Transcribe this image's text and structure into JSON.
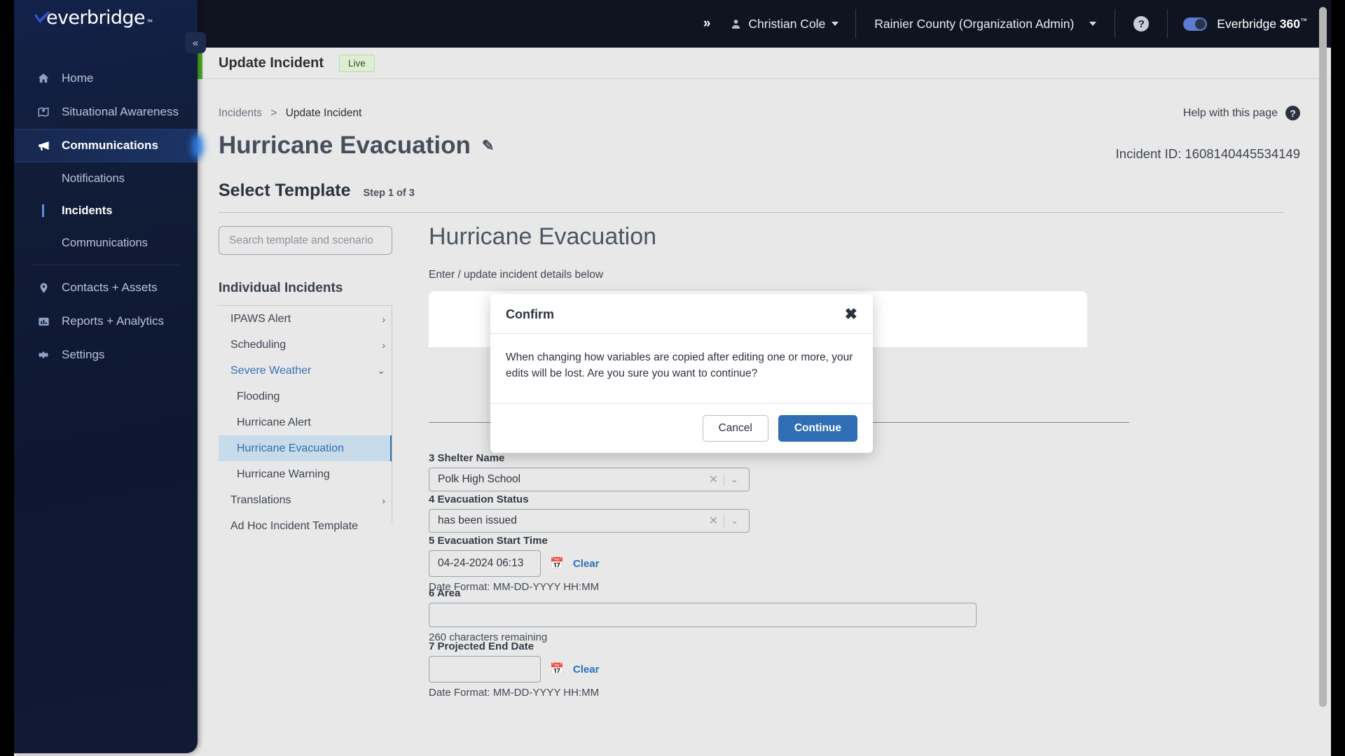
{
  "topbar": {
    "expand_icon": "double-chevron-right-icon",
    "user_name": "Christian Cole",
    "organization": "Rainier County (Organization Admin)",
    "help_icon": "question-mark-icon",
    "brand_label": "Everbridge 360",
    "brand_tm": "™",
    "toggle_state": "on"
  },
  "sidebar": {
    "logo_text": "everbridge",
    "logo_tm": "™",
    "collapse_icon": "double-chevron-left-icon",
    "items": [
      {
        "label": "Home",
        "icon": "home-icon",
        "active": false
      },
      {
        "label": "Situational Awareness",
        "icon": "map-pin-icon",
        "active": false
      },
      {
        "label": "Communications",
        "icon": "megaphone-icon",
        "active": true
      },
      {
        "label": "Contacts + Assets",
        "icon": "location-pin-icon",
        "active": false
      },
      {
        "label": "Reports + Analytics",
        "icon": "bar-chart-icon",
        "active": false
      },
      {
        "label": "Settings",
        "icon": "gear-icon",
        "active": false
      }
    ],
    "sub_items": [
      {
        "label": "Notifications",
        "selected": false
      },
      {
        "label": "Incidents",
        "selected": true
      },
      {
        "label": "Communications",
        "selected": false
      }
    ]
  },
  "page_header": {
    "title": "Update Incident",
    "status_badge": "Live"
  },
  "breadcrumb": {
    "parent": "Incidents",
    "separator": ">",
    "current": "Update Incident"
  },
  "help": {
    "label": "Help with this page",
    "icon": "question-mark-icon"
  },
  "incident": {
    "name": "Hurricane Evacuation",
    "edit_icon": "pencil-icon",
    "id_label": "Incident ID: 1608140445534149"
  },
  "step": {
    "heading": "Select Template",
    "progress": "Step 1 of 3"
  },
  "template_panel": {
    "search_placeholder": "Search template and scenario",
    "search_value": "",
    "group_heading": "Individual Incidents",
    "tree": [
      {
        "label": "IPAWS Alert",
        "type": "group",
        "state": "collapsed",
        "icon": "chevron-right-icon"
      },
      {
        "label": "Scheduling",
        "type": "group",
        "state": "collapsed",
        "icon": "chevron-right-icon"
      },
      {
        "label": "Severe Weather",
        "type": "group",
        "state": "expanded",
        "icon": "chevron-down-icon"
      },
      {
        "label": "Flooding",
        "type": "leaf",
        "active": false
      },
      {
        "label": "Hurricane Alert",
        "type": "leaf",
        "active": false
      },
      {
        "label": "Hurricane Evacuation",
        "type": "leaf",
        "active": true
      },
      {
        "label": "Hurricane Warning",
        "type": "leaf",
        "active": false
      },
      {
        "label": "Translations",
        "type": "group",
        "state": "collapsed",
        "icon": "chevron-right-icon"
      },
      {
        "label": "Ad Hoc Incident Template",
        "type": "item"
      }
    ]
  },
  "detail_panel": {
    "title": "Hurricane Evacuation",
    "subtitle": "Enter / update incident details below",
    "fields": [
      {
        "label": "3 Shelter Name",
        "value": "Polk High School",
        "control": "select",
        "clear_icon": "x-icon",
        "chevron_icon": "chevron-down-icon"
      },
      {
        "label": "4 Evacuation Status",
        "value": "has been issued",
        "control": "select",
        "clear_icon": "x-icon",
        "chevron_icon": "chevron-down-icon"
      },
      {
        "label": "5 Evacuation Start Time",
        "value": "04-24-2024 06:13",
        "control": "datetime",
        "calendar_icon": "calendar-icon",
        "clear_label": "Clear",
        "format_note": "Date Format: MM-DD-YYYY HH:MM"
      },
      {
        "label": "6 Area",
        "value": "",
        "control": "textarea",
        "counter": "260 characters remaining"
      },
      {
        "label": "7 Projected End Date",
        "value": "",
        "control": "datetime",
        "calendar_icon": "calendar-icon",
        "clear_label": "Clear",
        "format_note": "Date Format: MM-DD-YYYY HH:MM"
      }
    ]
  },
  "modal": {
    "title": "Confirm",
    "close_icon": "close-x-icon",
    "message": "When changing how variables are copied after editing one or more, your edits will be lost. Are you sure you want to continue?",
    "cancel_label": "Cancel",
    "continue_label": "Continue"
  },
  "colors": {
    "sidebar_bg": "#111c38",
    "topbar_bg": "#0f1420",
    "accent_blue": "#2f6eb5",
    "status_green": "#4caf26",
    "selection_blue": "#c7dbea",
    "page_bg": "#e8e8e8"
  }
}
